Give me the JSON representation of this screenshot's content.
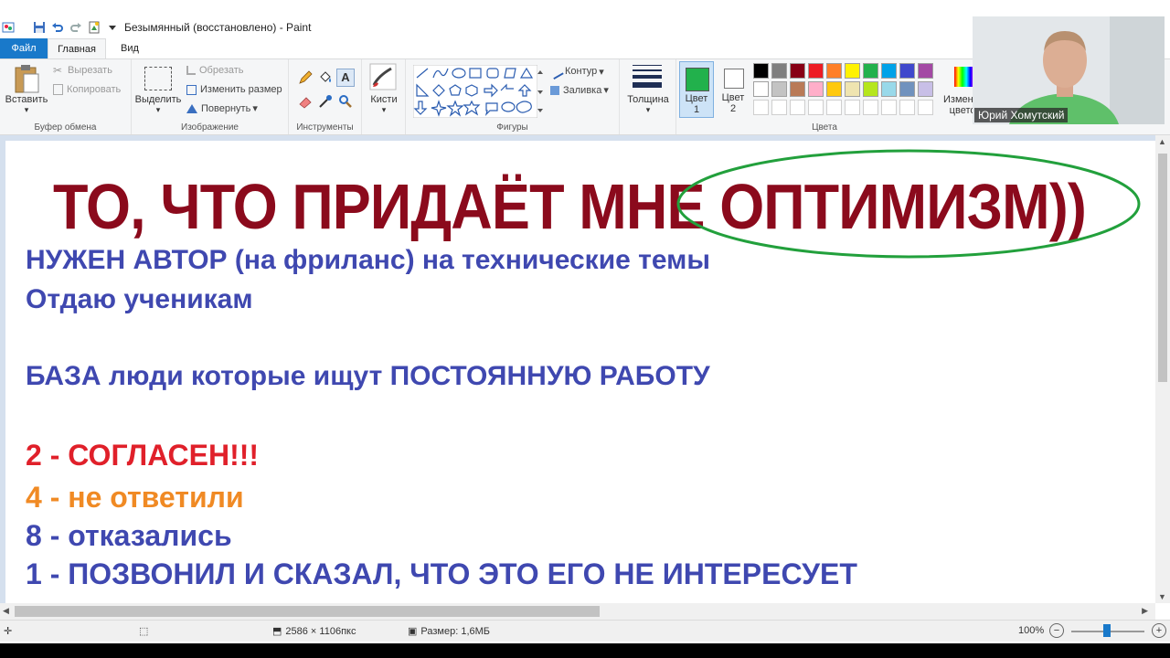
{
  "window": {
    "title": "Безымянный (восстановлено) - Paint"
  },
  "tabs": {
    "file": "Файл",
    "home": "Главная",
    "view": "Вид"
  },
  "ribbon": {
    "clipboard": {
      "paste": "Вставить",
      "cut": "Вырезать",
      "copy": "Копировать",
      "label": "Буфер обмена"
    },
    "image": {
      "select": "Выделить",
      "crop": "Обрезать",
      "resize": "Изменить размер",
      "rotate": "Повернуть",
      "label": "Изображение"
    },
    "tools": {
      "label": "Инструменты"
    },
    "brushes": {
      "label": "Кисти"
    },
    "shapes": {
      "outline": "Контур",
      "fill": "Заливка",
      "label": "Фигуры"
    },
    "size": {
      "label": "Толщина"
    },
    "colors": {
      "color1": "Цвет",
      "color1_num": "1",
      "color2": "Цвет",
      "color2_num": "2",
      "edit": "Изменение цветов",
      "label": "Цвета",
      "color1_value": "#22b14c",
      "color2_value": "#ffffff",
      "palette_row1": [
        "#000000",
        "#7f7f7f",
        "#880015",
        "#ed1c24",
        "#ff7f27",
        "#fff200",
        "#22b14c",
        "#00a2e8",
        "#3f48cc",
        "#a349a4"
      ],
      "palette_row2": [
        "#ffffff",
        "#c3c3c3",
        "#b97a57",
        "#ffaec9",
        "#ffc90e",
        "#efe4b0",
        "#b5e61d",
        "#99d9ea",
        "#7092be",
        "#c8bfe7"
      ]
    }
  },
  "canvas": {
    "headline": "ТО, ЧТО ПРИДАЁТ МНЕ ОПТИМИЗМ))",
    "line1": "НУЖЕН АВТОР (на фриланс) на технические темы",
    "line2": "Отдаю ученикам",
    "line3": "БАЗА люди которые ищут ПОСТОЯННУЮ РАБОТУ",
    "line4": "2 - СОГЛАСЕН!!!",
    "line5": "4 - не ответили",
    "line6": "8 - отказались",
    "line7": "1 - ПОЗВОНИЛ И СКАЗАЛ, ЧТО ЭТО ЕГО НЕ ИНТЕРЕСУЕТ",
    "colors": {
      "headline": "#8b0a1c",
      "blue": "#3f48b0",
      "red": "#e0202a",
      "orange": "#f08a24",
      "ellipse": "#22a03c"
    }
  },
  "status": {
    "dimensions": "2586 × 1106пкс",
    "size": "Размер: 1,6МБ",
    "zoom": "100%"
  },
  "webcam": {
    "name": "Юрий Хомутский"
  }
}
